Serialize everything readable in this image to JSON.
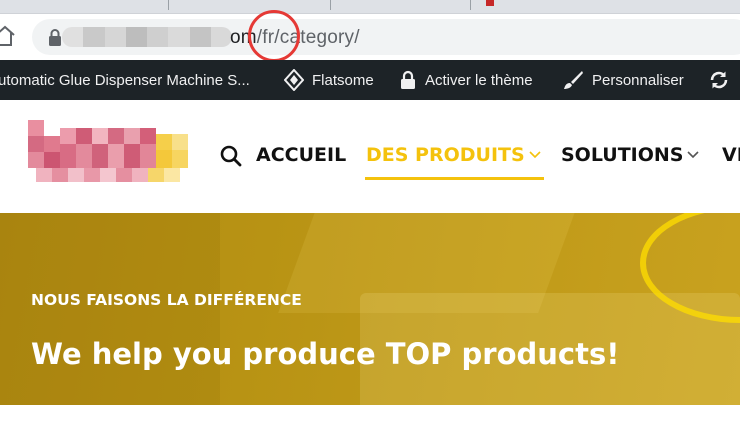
{
  "browser": {
    "url_suffix": "om/fr/category/",
    "url_host_part": "om",
    "url_path_part": "/fr/category/"
  },
  "admin_bar": {
    "items": [
      {
        "label": "utomatic Glue Dispenser Machine S...",
        "icon": "none"
      },
      {
        "label": "Flatsome",
        "icon": "flatsome-diamond-icon"
      },
      {
        "label": "Activer le thème",
        "icon": "lock-icon"
      },
      {
        "label": "Personnaliser",
        "icon": "brush-icon"
      },
      {
        "label": "",
        "icon": "refresh-icon"
      }
    ]
  },
  "site_nav": {
    "items": [
      {
        "label": "ACCUEIL",
        "active": false,
        "dropdown": false
      },
      {
        "label": "DES PRODUITS",
        "active": true,
        "dropdown": true
      },
      {
        "label": "SOLUTIONS",
        "active": false,
        "dropdown": true
      },
      {
        "label": "VI",
        "active": false,
        "dropdown": false
      }
    ],
    "accent_color": "#f4c20d"
  },
  "hero": {
    "eyebrow": "NOUS FAISONS LA DIFFÉRENCE",
    "headline": "We help you produce TOP products!"
  },
  "colors": {
    "admin_bar_bg": "#1d2327",
    "hero_bg": "#b89314",
    "annotation_circle": "#e53935"
  }
}
